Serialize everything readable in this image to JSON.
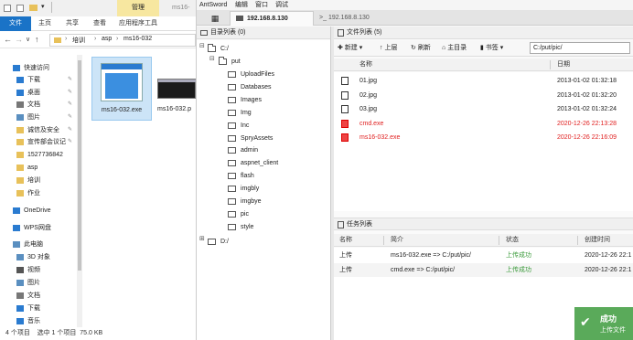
{
  "explorer": {
    "ribbon_tabs": [
      "文件",
      "主页",
      "共享",
      "查看",
      "应用程序工具"
    ],
    "manage_tab": "管理",
    "title_fragment": "ms16-",
    "breadcrumb": [
      "培训",
      "asp",
      "ms16-032"
    ],
    "nav_items": [
      {
        "label": "快速访问",
        "icon": "star-icon"
      },
      {
        "label": "下载",
        "icon": "download-icon"
      },
      {
        "label": "桌面",
        "icon": "desktop-icon"
      },
      {
        "label": "文档",
        "icon": "document-icon"
      },
      {
        "label": "图片",
        "icon": "picture-icon"
      },
      {
        "label": "诚信及安全",
        "icon": "folder-icon"
      },
      {
        "label": "宣传部会议记",
        "icon": "folder-icon"
      },
      {
        "label": "1527736842",
        "icon": "folder-icon"
      },
      {
        "label": "asp",
        "icon": "folder-icon"
      },
      {
        "label": "培训",
        "icon": "folder-icon"
      },
      {
        "label": "作业",
        "icon": "folder-icon"
      },
      {
        "label": "OneDrive",
        "icon": "cloud-icon"
      },
      {
        "label": "WPS网盘",
        "icon": "cloud-icon"
      },
      {
        "label": "此电脑",
        "icon": "computer-icon"
      },
      {
        "label": "3D 对象",
        "icon": "cube-icon"
      },
      {
        "label": "视频",
        "icon": "video-icon"
      },
      {
        "label": "图片",
        "icon": "picture-icon"
      },
      {
        "label": "文档",
        "icon": "document-icon"
      },
      {
        "label": "下载",
        "icon": "download-icon"
      },
      {
        "label": "音乐",
        "icon": "music-icon"
      }
    ],
    "files": [
      {
        "name": "ms16-032.exe"
      },
      {
        "name": "ms16-032.p"
      }
    ],
    "status": "4 个项目    选中 1 个项目  75.0 KB"
  },
  "antsword": {
    "menu": [
      "AntSword",
      "编辑",
      "窗口",
      "调试"
    ],
    "tabs": [
      "192.168.8.130",
      "192.168.8.130"
    ],
    "dir_panel_title": "目录列表 (0)",
    "tree": {
      "root": "C:/",
      "put": "put",
      "children": [
        "UploadFiles",
        "Databases",
        "Images",
        "Img",
        "Inc",
        "SpryAssets",
        "admin",
        "aspnet_client",
        "flash",
        "imgbly",
        "imgbye",
        "pic",
        "style"
      ],
      "drive_d": "D:/"
    },
    "file_panel_title": "文件列表 (5)",
    "toolbar": {
      "new": "新建",
      "up": "上层",
      "refresh": "刷新",
      "home": "主目录",
      "bookmark": "书签",
      "path": "C:/put/pic/"
    },
    "file_columns": [
      "名称",
      "日期"
    ],
    "file_rows": [
      {
        "name": "01.jpg",
        "date": "2013-01-02 01:32:18",
        "red": false
      },
      {
        "name": "02.jpg",
        "date": "2013-01-02 01:32:20",
        "red": false
      },
      {
        "name": "03.jpg",
        "date": "2013-01-02 01:32:24",
        "red": false
      },
      {
        "name": "cmd.exe",
        "date": "2020-12-26 22:13:28",
        "red": true
      },
      {
        "name": "ms16-032.exe",
        "date": "2020-12-26 22:16:09",
        "red": true
      }
    ],
    "task_panel_title": "任务列表",
    "task_columns": [
      "名称",
      "简介",
      "状态",
      "创建时间"
    ],
    "task_rows": [
      {
        "name": "上传",
        "desc": "ms16-032.exe => C:/put/pic/",
        "status": "上传成功",
        "time": "2020-12-26 22:1"
      },
      {
        "name": "上传",
        "desc": "cmd.exe => C:/put/pic/",
        "status": "上传成功",
        "time": "2020-12-26 22:1"
      }
    ],
    "toast": {
      "title": "成功",
      "message": "上传文件"
    }
  },
  "colors": {
    "accent": "#1a73c7",
    "success": "#3a9a3a",
    "red_file": "#e02020",
    "toast_bg": "#5aaa5a"
  }
}
